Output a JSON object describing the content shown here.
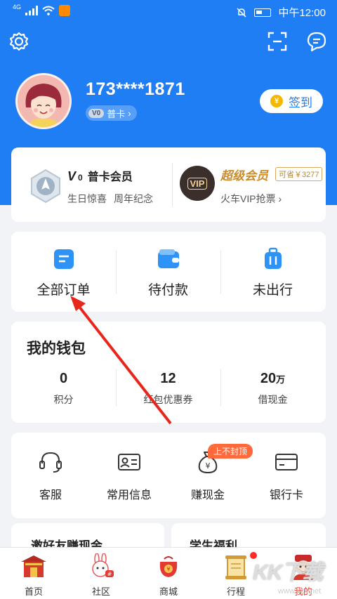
{
  "status_bar": {
    "network": "4G",
    "time": "中午12:00"
  },
  "header": {
    "settings_icon": "gear-icon",
    "scan_icon": "scan-icon",
    "message_icon": "message-icon"
  },
  "profile": {
    "phone": "173****1871",
    "level_badge": "V0",
    "level_label": "普卡",
    "checkin_label": "签到",
    "checkin_coin": "¥"
  },
  "membership": {
    "basic": {
      "level_mark": "V",
      "level_num": "0",
      "title": "普卡会员",
      "perks": [
        "生日惊喜",
        "周年纪念"
      ]
    },
    "super": {
      "title": "超级会员",
      "save_tag": "可省￥3277",
      "vip_badge": "VIP",
      "subtitle": "火车VIP抢票"
    }
  },
  "orders": [
    {
      "label": "全部订单",
      "icon": "all-orders-icon"
    },
    {
      "label": "待付款",
      "icon": "wallet-icon"
    },
    {
      "label": "未出行",
      "icon": "luggage-icon"
    }
  ],
  "wallet": {
    "title": "我的钱包",
    "items": [
      {
        "value": "0",
        "unit": "",
        "label": "积分"
      },
      {
        "value": "12",
        "unit": "",
        "label": "红包优惠券"
      },
      {
        "value": "20",
        "unit": "万",
        "label": "借现金"
      }
    ]
  },
  "services": {
    "hot_tag": "上不封顶",
    "items": [
      {
        "label": "客服",
        "icon": "headset-icon"
      },
      {
        "label": "常用信息",
        "icon": "id-card-icon"
      },
      {
        "label": "赚现金",
        "icon": "money-bag-icon"
      },
      {
        "label": "银行卡",
        "icon": "bank-card-icon"
      }
    ]
  },
  "promos": [
    "邀好友赚现金",
    "学生福利"
  ],
  "tabs": [
    {
      "label": "首页",
      "icon": "home-gate-icon"
    },
    {
      "label": "社区",
      "icon": "community-rabbit-icon"
    },
    {
      "label": "商城",
      "icon": "shop-bag-icon"
    },
    {
      "label": "行程",
      "icon": "trip-scroll-icon"
    },
    {
      "label": "我的",
      "icon": "profile-god-icon",
      "active": true
    }
  ],
  "watermark": {
    "text": "KK下载",
    "sub": "www.kkx.net"
  },
  "colors": {
    "primary_blue": "#1f7ef4",
    "accent_red": "#e8382f",
    "gold": "#c98d2b",
    "page_bg": "#f2f3f7"
  }
}
